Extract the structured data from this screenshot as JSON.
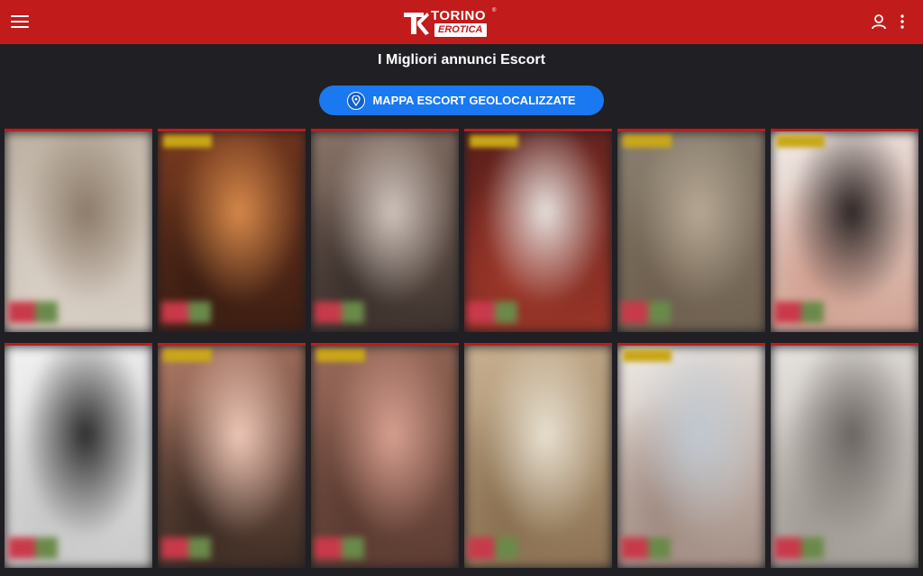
{
  "header": {
    "menu_icon": "hamburger-menu-icon",
    "logo": {
      "top": "TORINO",
      "bottom": "EROTICA",
      "registered": "®"
    },
    "user_icon": "user-icon",
    "more_icon": "vertical-dots-icon",
    "background_color": "#c11b1b"
  },
  "main": {
    "title": "I Migliori annunci Escort",
    "map_button": {
      "label": "MAPPA ESCORT GEOLOCALIZZATE",
      "icon": "map-pin-icon",
      "color": "#1a78f0"
    }
  },
  "listings": [
    {
      "badge": false,
      "colors": [
        "#bdb1a2",
        "#8c7a68",
        "#d8cfc5"
      ]
    },
    {
      "badge": true,
      "colors": [
        "#7a3a1f",
        "#d88a4a",
        "#3a1d12"
      ]
    },
    {
      "badge": false,
      "colors": [
        "#8a7468",
        "#cfc4bd",
        "#3a2f2a"
      ]
    },
    {
      "badge": true,
      "colors": [
        "#5a1e1a",
        "#e8e3e0",
        "#9a3528"
      ]
    },
    {
      "badge": true,
      "colors": [
        "#8a8070",
        "#b7a894",
        "#6f604f"
      ]
    },
    {
      "badge": true,
      "colors": [
        "#f0ebe8",
        "#2a2222",
        "#d0a090"
      ]
    },
    {
      "badge": false,
      "colors": [
        "#f2f2f2",
        "#2a2a2a",
        "#c8c8c8"
      ]
    },
    {
      "badge": true,
      "colors": [
        "#b07a66",
        "#f0c8b8",
        "#3a2a22"
      ]
    },
    {
      "badge": true,
      "colors": [
        "#9a6a5a",
        "#d8a090",
        "#5a3a30"
      ]
    },
    {
      "badge": false,
      "colors": [
        "#c8b090",
        "#e8e0d0",
        "#8a7050"
      ]
    },
    {
      "badge": true,
      "colors": [
        "#f0ece8",
        "#c0c8d0",
        "#a08a80"
      ]
    },
    {
      "badge": false,
      "colors": [
        "#e8e4e0",
        "#6a6460",
        "#a09a94"
      ]
    }
  ]
}
